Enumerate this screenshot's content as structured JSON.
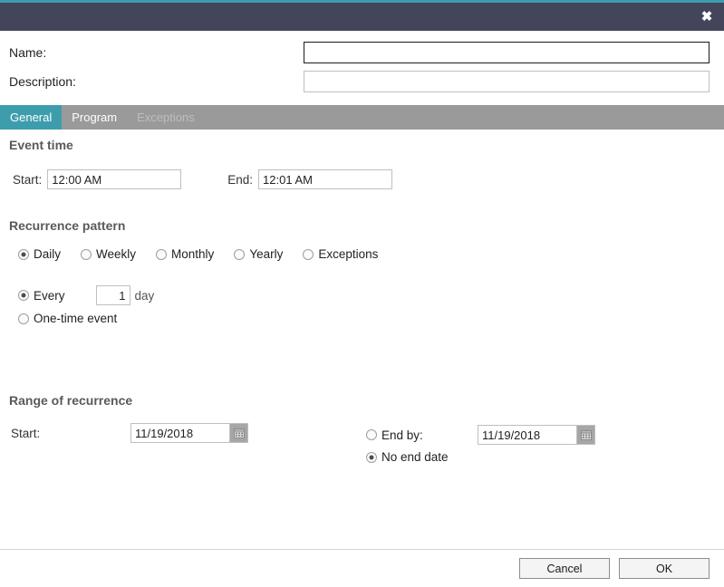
{
  "titlebar": {
    "close_label": "✖"
  },
  "header": {
    "name_label": "Name:",
    "name_value": "",
    "name_placeholder": "",
    "description_label": "Description:",
    "description_value": "",
    "description_placeholder": ""
  },
  "tabs": [
    {
      "label": "General",
      "state": "active"
    },
    {
      "label": "Program",
      "state": "normal"
    },
    {
      "label": "Exceptions",
      "state": "disabled"
    }
  ],
  "event_time": {
    "title": "Event time",
    "start_label": "Start:",
    "start_value": "12:00 AM",
    "end_label": "End:",
    "end_value": "12:01 AM"
  },
  "recurrence_pattern": {
    "title": "Recurrence pattern",
    "options": [
      {
        "label": "Daily",
        "checked": true
      },
      {
        "label": "Weekly",
        "checked": false
      },
      {
        "label": "Monthly",
        "checked": false
      },
      {
        "label": "Yearly",
        "checked": false
      },
      {
        "label": "Exceptions",
        "checked": false
      }
    ],
    "every_label": "Every",
    "every_checked": true,
    "interval_value": "1",
    "interval_unit": "day",
    "onetime_label": "One-time event",
    "onetime_checked": false
  },
  "range_of_recurrence": {
    "title": "Range of recurrence",
    "start_label": "Start:",
    "start_date": "11/19/2018",
    "end_by_label": "End by:",
    "end_by_checked": false,
    "end_by_date": "11/19/2018",
    "no_end_label": "No end date",
    "no_end_checked": true
  },
  "footer": {
    "cancel_label": "Cancel",
    "ok_label": "OK"
  },
  "colors": {
    "titlebar": "#43465a",
    "accent": "#3e9dad",
    "tabstrip": "#9a9a9a"
  }
}
